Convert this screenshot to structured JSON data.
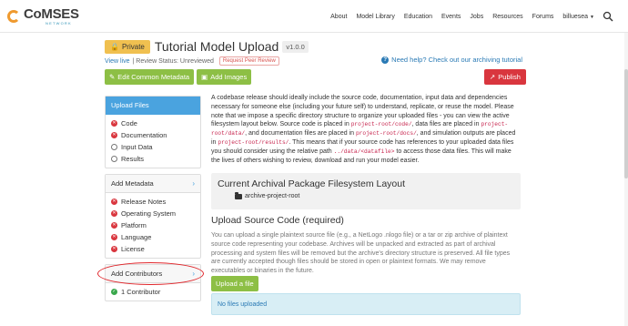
{
  "header": {
    "logo_name": "CoMSES",
    "logo_sub": "NETWORK",
    "nav": [
      "About",
      "Model Library",
      "Education",
      "Events",
      "Jobs",
      "Resources",
      "Forums"
    ],
    "user": "billuesea",
    "search_icon": "search-icon"
  },
  "page": {
    "private_label": "Private",
    "title": "Tutorial Model Upload",
    "version": "v1.0.0",
    "view_live": "View live",
    "review_status": "| Review Status: Unreviewed",
    "peer_review": "Request Peer Review",
    "help_link": "Need help? Check out our archiving tutorial",
    "edit_metadata": "Edit Common Metadata",
    "add_images": "Add Images",
    "publish": "Publish"
  },
  "sidebar": {
    "upload_files": {
      "title": "Upload Files",
      "items": [
        {
          "label": "Code",
          "status": "missing"
        },
        {
          "label": "Documentation",
          "status": "missing"
        },
        {
          "label": "Input Data",
          "status": "optional"
        },
        {
          "label": "Results",
          "status": "optional"
        }
      ]
    },
    "add_metadata": {
      "title": "Add Metadata",
      "items": [
        {
          "label": "Release Notes",
          "status": "missing"
        },
        {
          "label": "Operating System",
          "status": "missing"
        },
        {
          "label": "Platform",
          "status": "missing"
        },
        {
          "label": "Language",
          "status": "missing"
        },
        {
          "label": "License",
          "status": "missing"
        }
      ]
    },
    "add_contributors": {
      "title": "Add Contributors",
      "items": [
        {
          "label": "1 Contributor",
          "status": "ok"
        }
      ]
    }
  },
  "main": {
    "intro_1": "A codebase release should ideally include the source code, documentation, input data and dependencies necessary for someone else (including your future self) to understand, replicate, or reuse the model. Please note that we impose a specific directory structure to organize your uploaded files - you can view the active filesystem layout below. Source code is placed in ",
    "code_1": "project-root/code/",
    "intro_2": ", data files are placed in ",
    "code_2": "project-root/data/",
    "intro_3": ", and documentation files are placed in ",
    "code_3": "project-root/docs/",
    "intro_4": ", and simulation outputs are placed in ",
    "code_4": "project-root/results/",
    "intro_5": ". This means that if your source code has references to your uploaded data files you should consider using the relative path ",
    "code_5": "../data/<datafile>",
    "intro_6": " to access those data files. This will make the lives of others wishing to review, download and run your model easier.",
    "archive_title": "Current Archival Package Filesystem Layout",
    "archive_root": "archive-project-root",
    "upload_title": "Upload Source Code (required)",
    "upload_desc": "You can upload a single plaintext source file (e.g., a NetLogo .nlogo file) or a tar or zip archive of plaintext source code representing your codebase. Archives will be unpacked and extracted as part of archival processing and system files will be removed but the archive's directory structure is preserved. All file types are currently accepted though files should be stored in open or plaintext formats. We may remove executables or binaries in the future.",
    "upload_button": "Upload a file",
    "no_files": "No files uploaded"
  }
}
